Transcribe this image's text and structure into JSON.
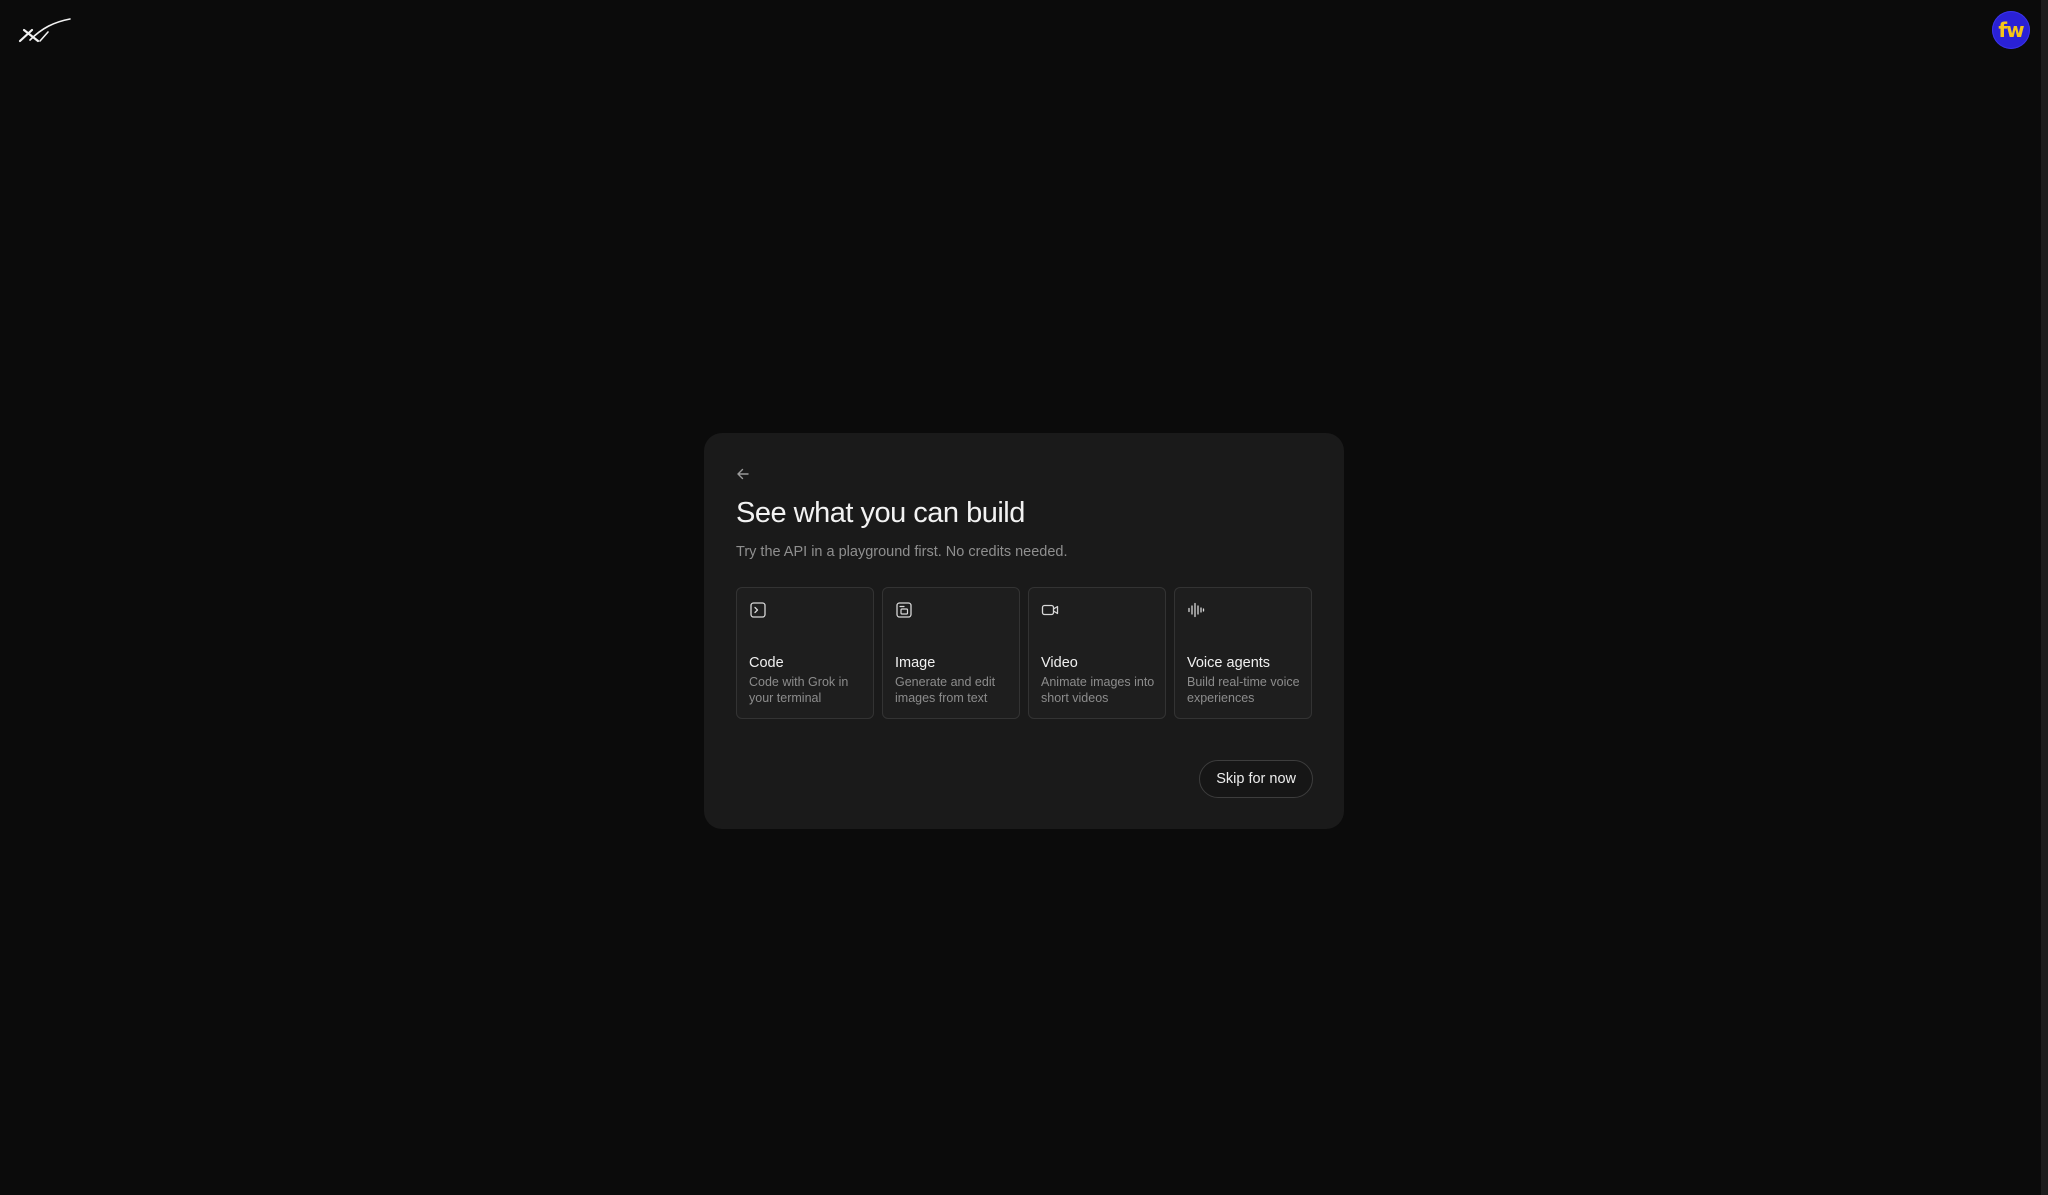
{
  "header": {
    "logo_icon": "xai-logo-icon",
    "avatar_text": "fw",
    "avatar_bg": "#2a21d6",
    "avatar_fg": "#f5c518"
  },
  "dialog": {
    "back_icon": "arrow-left-icon",
    "title": "See what you can build",
    "subtitle": "Try the API in a playground first. No credits needed.",
    "options": [
      {
        "icon": "terminal-icon",
        "title": "Code",
        "description": "Code with Grok in your terminal"
      },
      {
        "icon": "image-icon",
        "title": "Image",
        "description": "Generate and edit images from text"
      },
      {
        "icon": "video-icon",
        "title": "Video",
        "description": "Animate images into short videos"
      },
      {
        "icon": "waveform-icon",
        "title": "Voice agents",
        "description": "Build real-time voice experiences"
      }
    ],
    "skip_label": "Skip for now"
  }
}
